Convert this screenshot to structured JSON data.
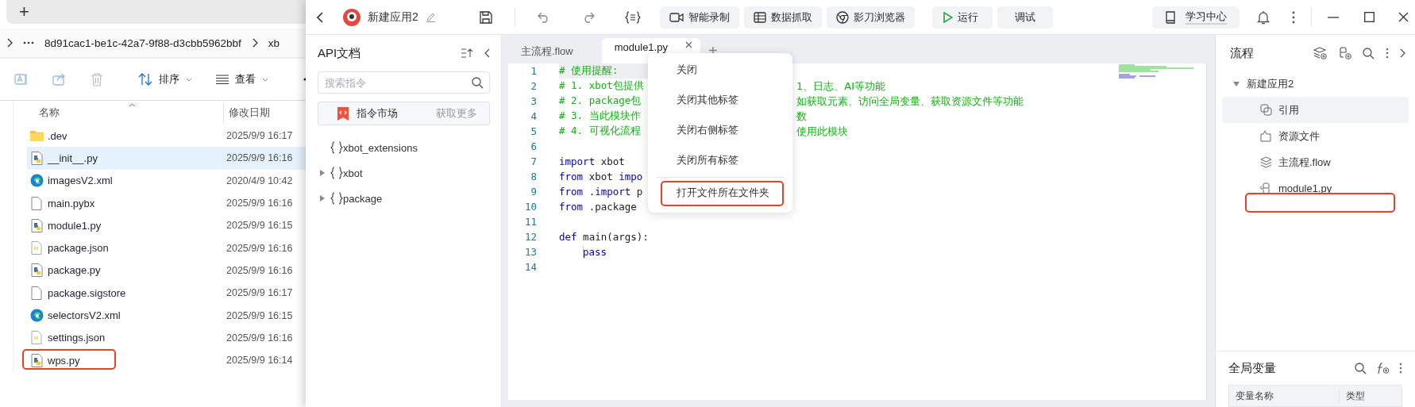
{
  "explorer": {
    "new_tab": "+",
    "address": [
      "8d91cac1-be1c-42a7-9f88-d3cbb5962bbf",
      "xb"
    ],
    "toolbar": {
      "sort": "排序",
      "view": "查看"
    },
    "columns": [
      "名称",
      "修改日期"
    ],
    "files": [
      {
        "name": ".dev",
        "date": "2025/9/9 16:17",
        "kind": "folder",
        "selected": false
      },
      {
        "name": "__init__.py",
        "date": "2025/9/9 16:16",
        "kind": "python",
        "selected": true
      },
      {
        "name": "imagesV2.xml",
        "date": "2020/4/9 10:42",
        "kind": "xml",
        "selected": false
      },
      {
        "name": "main.pybx",
        "date": "2025/9/9 16:16",
        "kind": "file",
        "selected": false
      },
      {
        "name": "module1.py",
        "date": "2025/9/9 16:15",
        "kind": "python",
        "selected": false
      },
      {
        "name": "package.json",
        "date": "2025/9/9 16:16",
        "kind": "json",
        "selected": false
      },
      {
        "name": "package.py",
        "date": "2025/9/9 16:16",
        "kind": "python",
        "selected": false
      },
      {
        "name": "package.sigstore",
        "date": "2025/9/9 16:17",
        "kind": "file",
        "selected": false
      },
      {
        "name": "selectorsV2.xml",
        "date": "2025/9/9 16:15",
        "kind": "xml",
        "selected": false
      },
      {
        "name": "settings.json",
        "date": "2025/9/9 16:16",
        "kind": "json",
        "selected": false
      },
      {
        "name": "wps.py",
        "date": "2025/9/9 16:14",
        "kind": "python",
        "selected": false
      }
    ]
  },
  "app": {
    "title": "新建应用2",
    "tools": [
      {
        "label": "智能录制",
        "kind": "record"
      },
      {
        "label": "数据抓取",
        "kind": "table"
      },
      {
        "label": "影刀浏览器",
        "kind": "browser"
      }
    ],
    "run": "运行",
    "debug": "调试",
    "learning_center": "学习中心"
  },
  "api_panel": {
    "title": "API文档",
    "search": {
      "placeholder": "搜索指令"
    },
    "market": {
      "label": "指令市场",
      "link": "获取更多"
    },
    "tree": [
      {
        "label": "xbot_extensions",
        "expandable": false
      },
      {
        "label": "xbot",
        "expandable": true
      },
      {
        "label": "package",
        "expandable": true
      }
    ]
  },
  "editor": {
    "tabs": [
      {
        "label": "主流程.flow",
        "selected": false
      },
      {
        "label": "module1.py",
        "selected": true
      }
    ],
    "add_tab": "+",
    "lines": [
      {
        "number": "1",
        "current": true,
        "tokens": [
          {
            "text": "# 使用提醒:",
            "kind": "comment"
          }
        ]
      },
      {
        "number": "2",
        "current": false,
        "tokens": [
          {
            "text": "# 1. xbot包提供",
            "kind": "comment"
          }
        ],
        "after": "1、日志、AI等功能"
      },
      {
        "number": "3",
        "current": false,
        "tokens": [
          {
            "text": "# 2. package包",
            "kind": "comment"
          }
        ],
        "after": "如获取元素、访问全局变量、获取资源文件等功能"
      },
      {
        "number": "4",
        "current": false,
        "tokens": [
          {
            "text": "# 3. 当此模块作",
            "kind": "comment"
          }
        ],
        "after": "数"
      },
      {
        "number": "5",
        "current": false,
        "tokens": [
          {
            "text": "# 4. 可视化流程",
            "kind": "comment"
          }
        ],
        "after": "使用此模块"
      },
      {
        "number": "6",
        "current": false
      },
      {
        "number": "7",
        "current": false,
        "tokens": [
          {
            "text": "import",
            "kind": "keyword"
          },
          {
            "text": " xbot",
            "kind": "plain"
          }
        ]
      },
      {
        "number": "8",
        "current": false,
        "tokens": [
          {
            "text": "from",
            "kind": "keyword"
          },
          {
            "text": " xbot ",
            "kind": "plain"
          },
          {
            "text": "impo",
            "kind": "keyword"
          }
        ]
      },
      {
        "number": "9",
        "current": false,
        "tokens": [
          {
            "text": "from",
            "kind": "keyword"
          },
          {
            "text": " .",
            "kind": "plain"
          },
          {
            "text": "import",
            "kind": "keyword"
          },
          {
            "text": " p",
            "kind": "plain"
          }
        ]
      },
      {
        "number": "10",
        "current": false,
        "tokens": [
          {
            "text": "from",
            "kind": "keyword"
          },
          {
            "text": " .package",
            "kind": "plain"
          }
        ]
      },
      {
        "number": "11",
        "current": false
      },
      {
        "number": "12",
        "current": false,
        "tokens": [
          {
            "text": "def",
            "kind": "keyword"
          },
          {
            "text": " main(args):",
            "kind": "plain"
          }
        ]
      },
      {
        "number": "13",
        "current": false,
        "indented": true,
        "tokens": [
          {
            "text": "pass",
            "kind": "keyword"
          }
        ]
      },
      {
        "number": "14",
        "current": false
      }
    ]
  },
  "context_menu": {
    "groups": [
      [
        "关闭",
        "关闭其他标签",
        "关闭右侧标签",
        "关闭所有标签"
      ],
      [
        "打开文件所在文件夹"
      ]
    ]
  },
  "flow_panel": {
    "title": "流程",
    "tree": [
      {
        "label": "新建应用2",
        "expanded": true,
        "children": [
          {
            "label": "引用",
            "kind": "reference",
            "selected": true
          },
          {
            "label": "资源文件",
            "kind": "resource",
            "selected": false
          },
          {
            "label": "主流程.flow",
            "kind": "flow",
            "selected": false
          },
          {
            "label": "module1.py",
            "kind": "python",
            "selected": false
          }
        ]
      }
    ]
  },
  "globals": {
    "title": "全局变量",
    "columns": [
      "变量名称",
      "类型"
    ]
  }
}
